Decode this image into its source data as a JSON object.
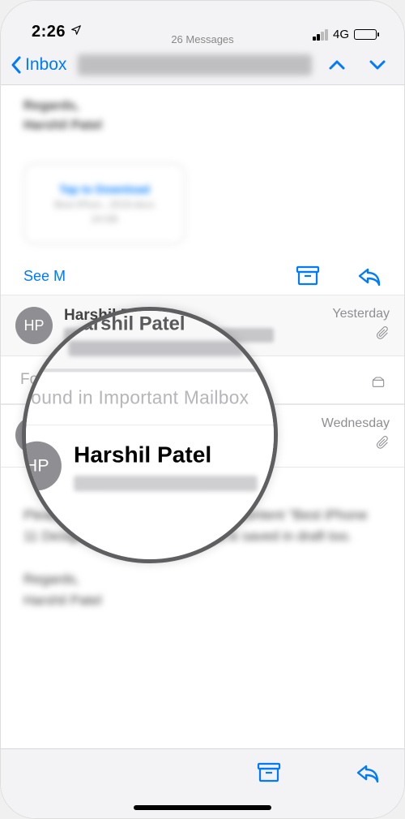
{
  "status": {
    "time": "2:26",
    "network": "4G"
  },
  "nav": {
    "back_label": "Inbox",
    "message_count": "26 Messages"
  },
  "top_message": {
    "signature_line1": "Regards,",
    "signature_line2": "Harshil Patel",
    "attachment": {
      "title": "Tap to Download",
      "sub": "Best iPhon...2019.docx",
      "size": "24 KB"
    },
    "see_more": "See M"
  },
  "thread": [
    {
      "initials": "HP",
      "sender": "Harshil Patel",
      "date": "Yesterday"
    },
    {
      "initials": "HP",
      "sender": "Harshil Patel",
      "date": "Wednesday"
    }
  ],
  "section_label": "Found in Important Mailbox",
  "body": {
    "para1": "Please find the attached file for the content \"Best iPhone 11 Designer Cases.\" The content is saved in draft too.",
    "sig1": "Regards,",
    "sig2": "Harshil Patel"
  },
  "magnifier": {
    "sender1": "Harshil Patel",
    "label": "Found in Important Mailbox",
    "sender2": "Harshil Patel",
    "initials": "HP"
  }
}
